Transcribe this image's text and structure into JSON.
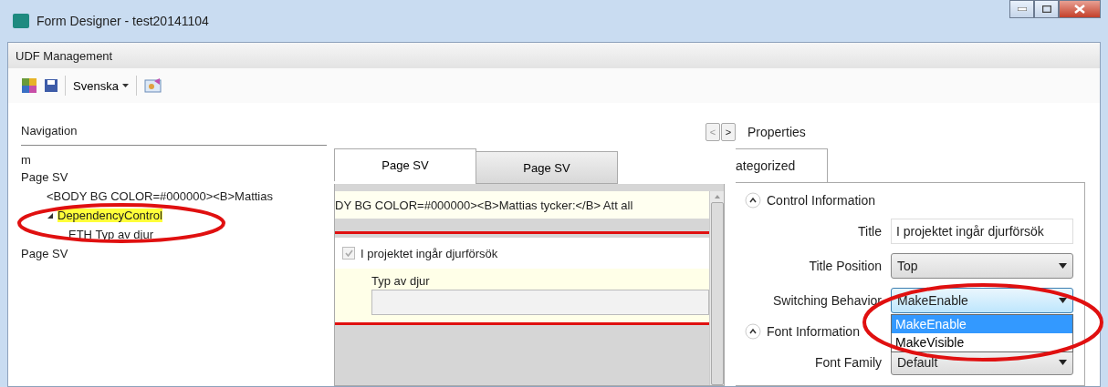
{
  "window": {
    "title": "Form Designer - test20141104"
  },
  "menu": [
    "UDF Management"
  ],
  "toolbar": {
    "language": "Svenska"
  },
  "navigation": {
    "title": "Navigation",
    "tree": [
      {
        "label": "m",
        "selected": false
      },
      {
        "label": "Page SV",
        "selected": false,
        "children": [
          {
            "label": "<BODY BG COLOR=#000000><B>Mattias",
            "selected": false
          },
          {
            "label": "DependencyControl",
            "selected": true,
            "expanded": true,
            "children": [
              {
                "label": "ETH Typ av djur",
                "selected": false
              }
            ]
          }
        ]
      },
      {
        "label": "Page SV",
        "selected": false
      }
    ]
  },
  "pager": [
    "<",
    ">"
  ],
  "designer": {
    "tabs": [
      {
        "label": "Page SV",
        "selected": true
      },
      {
        "label": "Page SV",
        "selected": false
      }
    ],
    "html_row": "DY BG COLOR=#000000><B>Mattias tycker:</B> Att all",
    "checkbox": {
      "label": "I projektet ingår djurförsök",
      "checked": true
    },
    "field": {
      "label": "Typ av djur"
    }
  },
  "properties": {
    "title": "Properties",
    "tab": "ategorized",
    "sections": [
      {
        "title": "Control Information",
        "expanded": true,
        "rows": [
          {
            "kind": "text",
            "label": "Title",
            "value": "I projektet ingår djurförsök"
          },
          {
            "kind": "select",
            "label": "Title Position",
            "value": "Top"
          },
          {
            "kind": "select",
            "label": "Switching Behavior",
            "value": "MakeEnable",
            "open": true,
            "options": [
              {
                "label": "MakeEnable",
                "selected": true
              },
              {
                "label": "MakeVisible",
                "selected": false
              }
            ]
          }
        ]
      },
      {
        "title": "Font Information",
        "expanded": true,
        "rows": [
          {
            "kind": "select",
            "label": "Font Family",
            "value": "Default"
          }
        ]
      }
    ]
  }
}
